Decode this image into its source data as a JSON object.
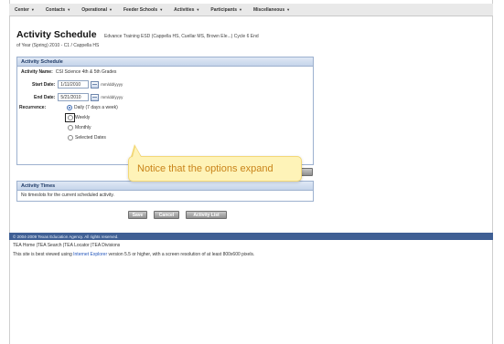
{
  "nav": {
    "items": [
      "Center",
      "Contacts",
      "Operational",
      "Feeder Schools",
      "Activities",
      "Participants",
      "Miscellaneous"
    ]
  },
  "header": {
    "title": "Activity Schedule",
    "subtitle": "Edvance Training ESD (Cappella HS, Cuellar MS, Brown Ele...) Cycle 6  End",
    "subline": "of Year (Spring)  2010 - C1 / Cappella HS"
  },
  "schedule": {
    "panel_title": "Activity Schedule",
    "activity_name_label": "Activity Name:",
    "activity_name_value": "CSI Science 4th & 5th Grades",
    "start_label": "Start Date:",
    "start_value": "1/11/2010",
    "end_label": "End Date:",
    "end_value": "5/21/2010",
    "date_format": "mm/dd/yyyy",
    "recurrence_label": "Recurrence:",
    "options": [
      "Daily (7 days a week)",
      "Weekly",
      "Monthly",
      "Selected Dates"
    ],
    "selected_option": "Daily (7 days a week)"
  },
  "times": {
    "panel_title": "Activity Times",
    "empty_text": "No timeslots for the current scheduled activity."
  },
  "buttons": {
    "save": "Save",
    "cancel": "Cancel",
    "activity_list": "Activity List"
  },
  "callout": {
    "text": "Notice that the options expand"
  },
  "footer": {
    "copyright": "© 2004-2009 Texas Education Agency. All rights reserved.",
    "links": "TEA Home  |TEA Search  |TEA Locator  |TEA Divisions",
    "note_before": "This site is best viewed using ",
    "note_link": "Internet Explorer",
    "note_after": " version 5.5 or higher, with a screen resolution of at least 800x600 pixels."
  },
  "colors": {
    "nav_bg": "#e9e9e9",
    "panel_header": "#c5d4ea",
    "footer_bar": "#3f5f94",
    "callout_bg": "#fef3b8",
    "callout_text": "#c9841a"
  }
}
